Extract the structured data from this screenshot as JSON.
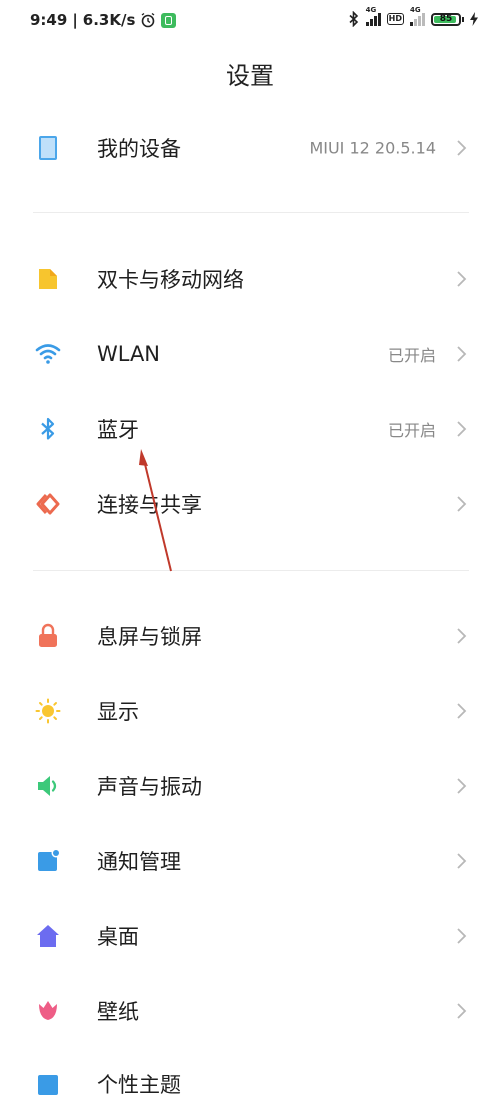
{
  "status_bar": {
    "time": "9:49",
    "net_speed": "6.3K/s",
    "sig1_tag": "4G",
    "sig2_tag": "4G",
    "hd_badge": "HD",
    "battery_level": "85",
    "battery_fraction": 0.85
  },
  "header": {
    "title": "设置"
  },
  "sections": {
    "device": {
      "label": "我的设备",
      "value": "MIUI 12 20.5.14"
    },
    "sim": {
      "label": "双卡与移动网络"
    },
    "wlan": {
      "label": "WLAN",
      "value": "已开启"
    },
    "bluetooth": {
      "label": "蓝牙",
      "value": "已开启"
    },
    "connection": {
      "label": "连接与共享"
    },
    "lock": {
      "label": "息屏与锁屏"
    },
    "display": {
      "label": "显示"
    },
    "sound": {
      "label": "声音与振动"
    },
    "notifications": {
      "label": "通知管理"
    },
    "desktop": {
      "label": "桌面"
    },
    "wallpaper": {
      "label": "壁纸"
    },
    "theme": {
      "label": "个性主题"
    }
  },
  "icons": {
    "device": "phone-icon",
    "sim": "sim-card-icon",
    "wlan": "wifi-icon",
    "bluetooth": "bluetooth-icon",
    "connection": "share-icon",
    "lock": "lock-icon",
    "display": "sun-icon",
    "sound": "speaker-icon",
    "notifications": "notification-icon",
    "desktop": "home-icon",
    "wallpaper": "tulip-icon",
    "theme": "theme-icon"
  },
  "colors": {
    "accent_blue": "#3a9be6",
    "sim_yellow": "#f7c52e",
    "share_red": "#ec6a4f",
    "lock_red": "#f0735a",
    "sun_yellow": "#f9c630",
    "sound_green": "#3cc97a",
    "home_purple": "#6c6cf0",
    "tulip_pink": "#ee5d86",
    "annotation_arrow": "#c0392b"
  }
}
